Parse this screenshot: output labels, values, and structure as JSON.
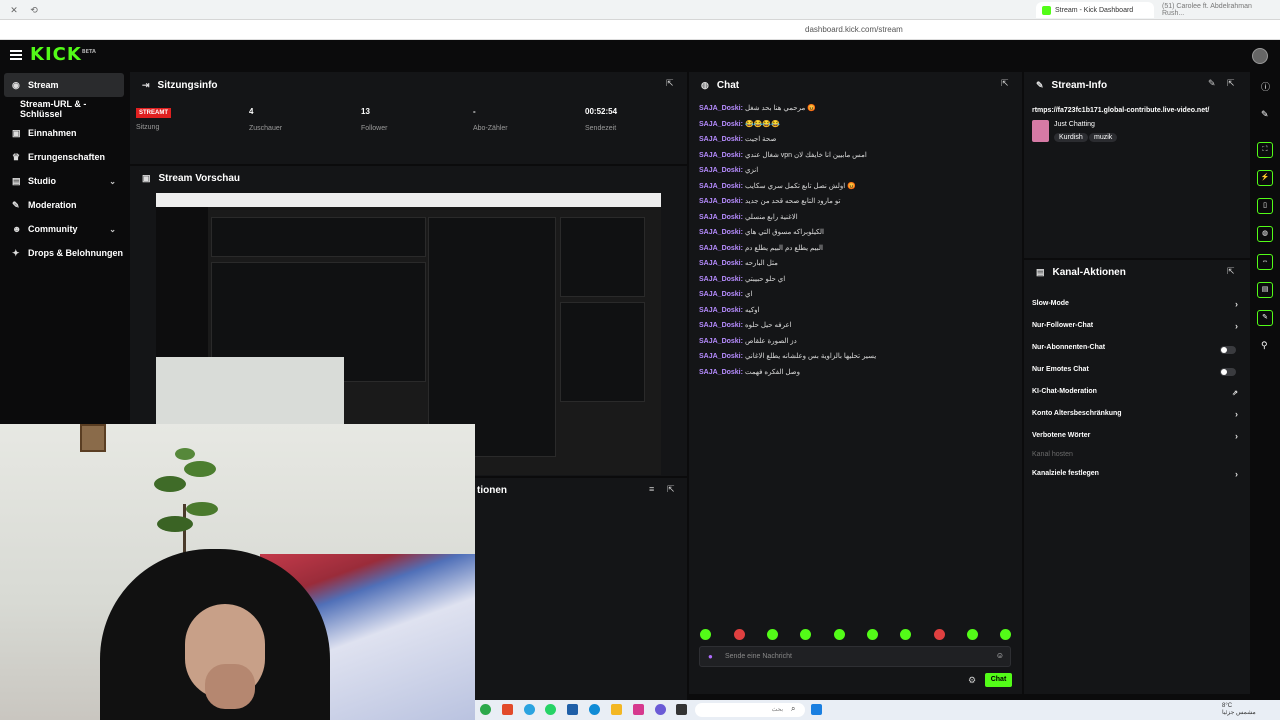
{
  "browser": {
    "tab_active": "Stream - Kick Dashboard",
    "tab_other": "(51) Carolee ft. Abdelrahman Rush...",
    "url": "dashboard.kick.com/stream"
  },
  "app": {
    "logo": "KICK",
    "logo_sup": "BETA"
  },
  "sidebar": {
    "items": [
      {
        "label": "Stream",
        "icon": "stream-icon"
      },
      {
        "label": "Stream-URL & -Schlüssel"
      },
      {
        "label": "Einnahmen",
        "icon": "wallet-icon"
      },
      {
        "label": "Errungenschaften",
        "icon": "trophy-icon"
      },
      {
        "label": "Studio",
        "icon": "studio-icon"
      },
      {
        "label": "Moderation",
        "icon": "wrench-icon"
      },
      {
        "label": "Community",
        "icon": "people-icon"
      },
      {
        "label": "Drops & Belohnungen",
        "icon": "gift-icon"
      }
    ]
  },
  "session": {
    "title": "Sitzungsinfo",
    "badge": "STREAMT",
    "stats": [
      {
        "value": "",
        "label": "Sitzung"
      },
      {
        "value": "4",
        "label": "Zuschauer"
      },
      {
        "value": "13",
        "label": "Follower"
      },
      {
        "value": "-",
        "label": "Abo-Zähler"
      },
      {
        "value": "00:52:54",
        "label": "Sendezeit"
      }
    ]
  },
  "preview": {
    "title": "Stream Vorschau"
  },
  "actions_left": {
    "title_fragment": "tionen"
  },
  "chat": {
    "title": "Chat",
    "messages": [
      {
        "user": "SAJA_Doski:",
        "text": "مرحمي هنا بحد شغل 😡"
      },
      {
        "user": "SAJA_Doski:",
        "text": "😂😂😂😂"
      },
      {
        "user": "SAJA_Doski:",
        "text": "صحة اجيت"
      },
      {
        "user": "SAJA_Doski:",
        "text": "شغال عندي vpn امس مابيين انا خايفك لان"
      },
      {
        "user": "SAJA_Doski:",
        "text": "انزي"
      },
      {
        "user": "SAJA_Doski:",
        "text": "اولش نصل تابع تكمل سري سكايب 😡"
      },
      {
        "user": "SAJA_Doski:",
        "text": "تو مارود التابع صحه قحد من جديد"
      },
      {
        "user": "SAJA_Doski:",
        "text": "الاغنية رابع منسلي"
      },
      {
        "user": "SAJA_Doski:",
        "text": "الكيلوبراكه مسوق التي هاي"
      },
      {
        "user": "SAJA_Doski:",
        "text": "البيم يطلع دم البيم يطلع دم"
      },
      {
        "user": "SAJA_Doski:",
        "text": "مثل البارحه"
      },
      {
        "user": "SAJA_Doski:",
        "text": "اي حلو حبيبتي"
      },
      {
        "user": "SAJA_Doski:",
        "text": "اي"
      },
      {
        "user": "SAJA_Doski:",
        "text": "اوكيه"
      },
      {
        "user": "SAJA_Doski:",
        "text": "اعرفه حيل حلوه"
      },
      {
        "user": "SAJA_Doski:",
        "text": "دز الصورة علقاص"
      },
      {
        "user": "SAJA_Doski:",
        "text": "يسير تحليها بالزاوية بس وعلشانه يطلع الاغاني"
      },
      {
        "user": "SAJA_Doski:",
        "text": "وصل الفكره فهمت"
      }
    ],
    "input_placeholder": "Sende eine Nachricht",
    "send_label": "Chat"
  },
  "stream_info": {
    "title": "Stream-Info",
    "url": "rtmps://fa723fc1b171.global-contribute.live-video.net/",
    "category": "Just Chatting",
    "tags": [
      "Kurdish",
      "muzik"
    ]
  },
  "channel_actions": {
    "title": "Kanal-Aktionen",
    "rows": [
      {
        "label": "Slow-Mode",
        "control": "chevron"
      },
      {
        "label": "Nur-Follower-Chat",
        "control": "chevron"
      },
      {
        "label": "Nur-Abonnenten-Chat",
        "control": "toggle"
      },
      {
        "label": "Nur Emotes Chat",
        "control": "toggle"
      },
      {
        "label": "KI-Chat-Moderation",
        "control": "external"
      },
      {
        "label": "Konto Altersbeschränkung",
        "control": "chevron"
      },
      {
        "label": "Verbotene Wörter",
        "control": "chevron"
      },
      {
        "label": "Kanal hosten",
        "control": "none",
        "disabled": true
      },
      {
        "label": "Kanalziele festlegen",
        "control": "chevron"
      }
    ]
  },
  "taskbar": {
    "search_placeholder": "بحث",
    "weather_temp": "8°C",
    "weather_text": "مشمس جزئيا"
  },
  "colors": {
    "accent": "#53fc18",
    "live": "#e02020",
    "username": "#b68cff",
    "panel": "#141517"
  }
}
